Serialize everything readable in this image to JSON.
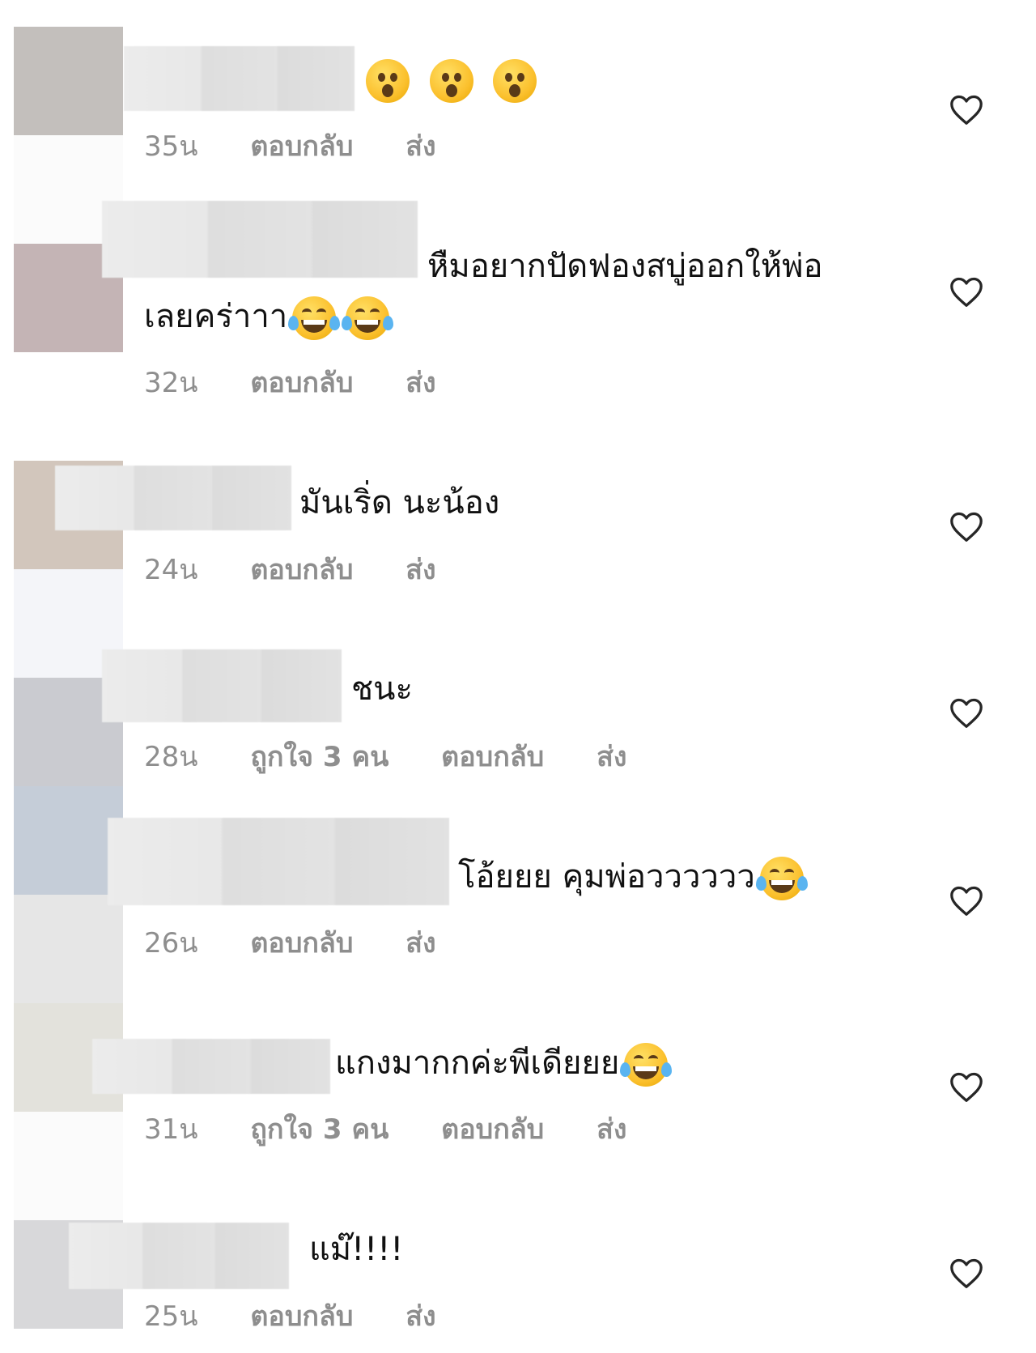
{
  "avatars": [
    {
      "color": "#c3bfbc"
    },
    {
      "color": "#fbfbfb"
    },
    {
      "color": "#c4b4b5"
    },
    {
      "color": "#ffffff"
    },
    {
      "color": "#d2c6bc"
    },
    {
      "color": "#f4f5f9"
    },
    {
      "color": "#cacbd0"
    },
    {
      "color": "#c5cdd8"
    },
    {
      "color": "#e6e6e6"
    },
    {
      "color": "#e3e2dc"
    },
    {
      "color": "#fbfbfb"
    },
    {
      "color": "#d8d8da"
    }
  ],
  "comments": [
    {
      "text": "",
      "emojis": [
        "astonished-emoji",
        "astonished-emoji",
        "astonished-emoji"
      ],
      "time": "35น",
      "likes": "",
      "reply": "ตอบกลับ",
      "send": "ส่ง"
    },
    {
      "text_line1": "หืมอยากปัดฟองสบู่ออกให้พ่อ",
      "text_line2": "เลยคร่าาา",
      "emojis": [
        "tears-of-joy-emoji",
        "tears-of-joy-emoji"
      ],
      "time": "32น",
      "likes": "",
      "reply": "ตอบกลับ",
      "send": "ส่ง"
    },
    {
      "text": "มันเริ่ด นะน้อง",
      "time": "24น",
      "likes": "",
      "reply": "ตอบกลับ",
      "send": "ส่ง"
    },
    {
      "text": "ชนะ",
      "time": "28น",
      "likes": "ถูกใจ 3 คน",
      "reply": "ตอบกลับ",
      "send": "ส่ง"
    },
    {
      "text": "โอ้ยยย คุมพ่อวววววว",
      "emojis": [
        "tears-of-joy-emoji"
      ],
      "time": "26น",
      "likes": "",
      "reply": "ตอบกลับ",
      "send": "ส่ง"
    },
    {
      "text": "แกงมากกค่ะพีเดียยย",
      "emojis": [
        "tears-of-joy-emoji"
      ],
      "time": "31น",
      "likes": "ถูกใจ 3 คน",
      "reply": "ตอบกลับ",
      "send": "ส่ง"
    },
    {
      "text": "แม๊!!!!",
      "time": "25น",
      "likes": "",
      "reply": "ตอบกลับ",
      "send": "ส่ง"
    }
  ]
}
